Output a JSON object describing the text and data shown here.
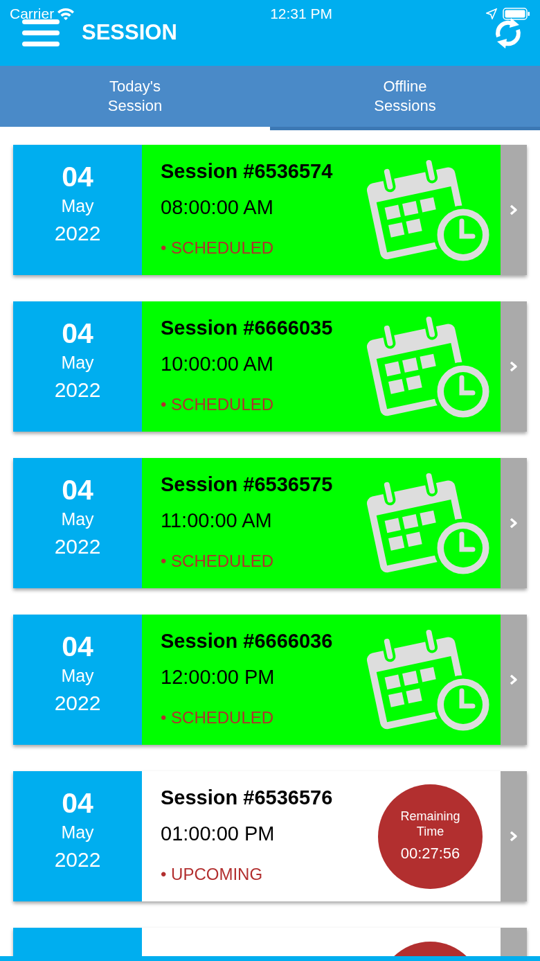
{
  "status_bar": {
    "carrier": "Carrier",
    "time": "12:31 PM"
  },
  "header": {
    "title": "SESSION"
  },
  "tabs": [
    {
      "label": "Today's\nSession",
      "selected": true
    },
    {
      "label": "Offline\nSessions",
      "selected": false
    }
  ],
  "sessions": [
    {
      "kind": "scheduled",
      "day": "04",
      "month": "May",
      "year": "2022",
      "title": "Session #6536574",
      "time": "08:00:00 AM",
      "status": "• SCHEDULED"
    },
    {
      "kind": "scheduled",
      "day": "04",
      "month": "May",
      "year": "2022",
      "title": "Session #6666035",
      "time": "10:00:00 AM",
      "status": "• SCHEDULED"
    },
    {
      "kind": "scheduled",
      "day": "04",
      "month": "May",
      "year": "2022",
      "title": "Session #6536575",
      "time": "11:00:00 AM",
      "status": "• SCHEDULED"
    },
    {
      "kind": "scheduled",
      "day": "04",
      "month": "May",
      "year": "2022",
      "title": "Session #6666036",
      "time": "12:00:00 PM",
      "status": "• SCHEDULED"
    },
    {
      "kind": "upcoming",
      "day": "04",
      "month": "May",
      "year": "2022",
      "title": "Session #6536576",
      "time": "01:00:00 PM",
      "status": "• UPCOMING",
      "remaining_label": "Remaining\nTime",
      "remaining_time": "00:27:56"
    },
    {
      "kind": "upcoming"
    }
  ]
}
